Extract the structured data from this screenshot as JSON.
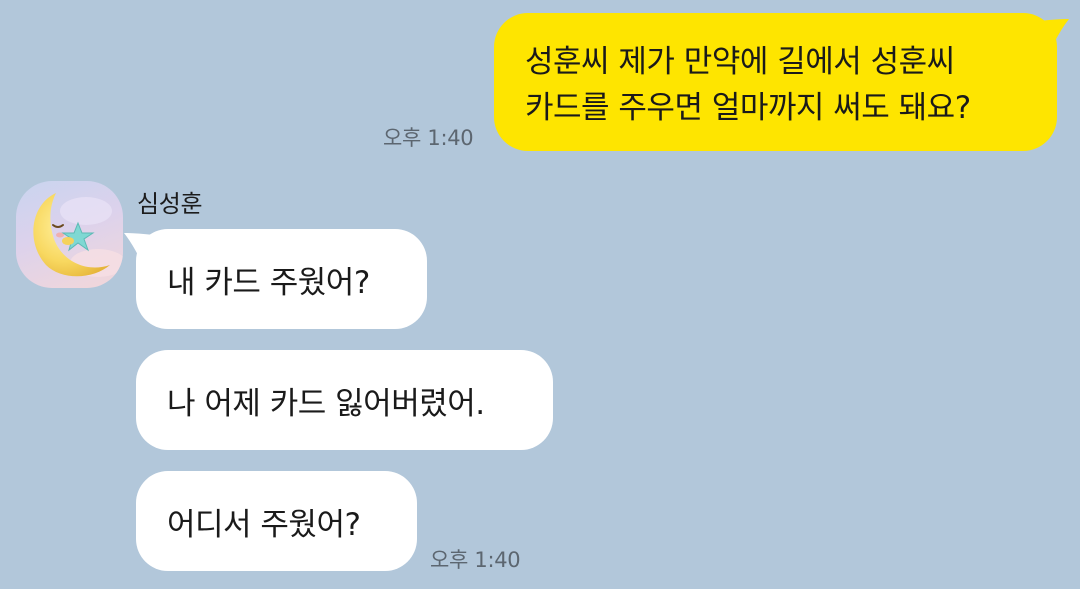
{
  "outgoing": {
    "lines": [
      "성훈씨 제가 만약에 길에서 성훈씨",
      "카드를 주우면 얼마까지 써도 돼요?"
    ],
    "time": "오후 1:40",
    "bubble_color": "#fee500"
  },
  "incoming": {
    "sender": "심성훈",
    "avatar_icon": "moon-character-icon",
    "messages": [
      {
        "text": "내 카드 주웠어?"
      },
      {
        "text": "나 어제 카드 잃어버렸어."
      },
      {
        "text": "어디서 주웠어?"
      }
    ],
    "time": "오후 1:40",
    "bubble_color": "#ffffff"
  },
  "colors": {
    "background": "#b2c7da",
    "time_text": "#5c6670"
  }
}
